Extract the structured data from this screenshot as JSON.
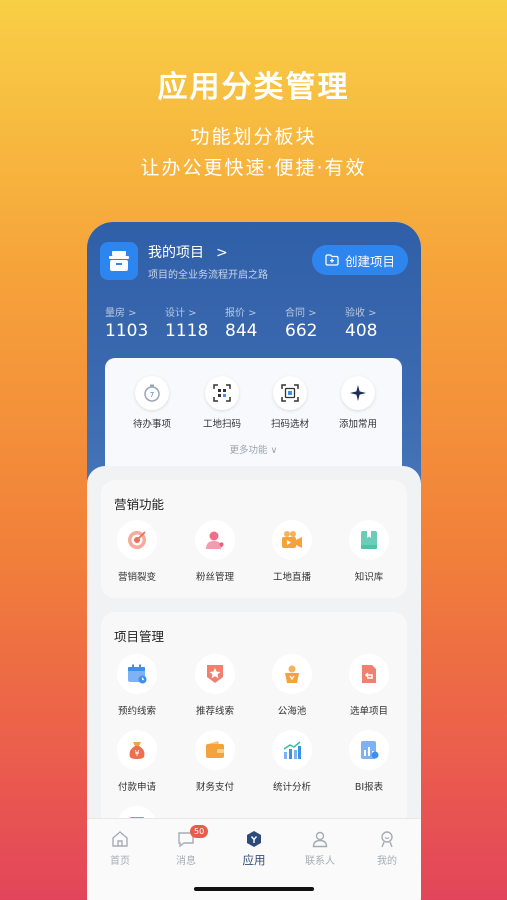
{
  "promo": {
    "title": "应用分类管理",
    "subtitle1": "功能划分板块",
    "subtitle2": "让办公更快速·便捷·有效"
  },
  "project": {
    "title": "我的项目",
    "chevron": ">",
    "desc": "项目的全业务流程开启之路",
    "create_label": "创建项目",
    "icon": "toolbox-icon"
  },
  "stats": [
    {
      "label": "量房 >",
      "value": "1103"
    },
    {
      "label": "设计 >",
      "value": "1118"
    },
    {
      "label": "报价 >",
      "value": "844"
    },
    {
      "label": "合同 >",
      "value": "662"
    },
    {
      "label": "验收 >",
      "value": "408"
    }
  ],
  "quick": {
    "items": [
      {
        "label": "待办事项",
        "icon": "stopwatch-icon"
      },
      {
        "label": "工地扫码",
        "icon": "scan-icon"
      },
      {
        "label": "扫码选材",
        "icon": "scan-material-icon"
      },
      {
        "label": "添加常用",
        "icon": "plus-star-icon"
      }
    ],
    "more": "更多功能  ∨"
  },
  "marketing": {
    "title": "营销功能",
    "items": [
      {
        "label": "营销裂变",
        "icon": "target-icon",
        "color": "#ee6f60"
      },
      {
        "label": "粉丝管理",
        "icon": "fan-user-icon",
        "color": "#ef6f8a"
      },
      {
        "label": "工地直播",
        "icon": "video-camera-icon",
        "color": "#f4a23c"
      },
      {
        "label": "知识库",
        "icon": "book-icon",
        "color": "#4fc1a9"
      }
    ]
  },
  "project_mgmt": {
    "title": "项目管理",
    "items": [
      {
        "label": "预约线索",
        "icon": "calendar-icon",
        "color": "#3d8ff0"
      },
      {
        "label": "推荐线索",
        "icon": "star-badge-icon",
        "color": "#ee5c4f"
      },
      {
        "label": "公海池",
        "icon": "trophy-icon",
        "color": "#f4a23c"
      },
      {
        "label": "选单项目",
        "icon": "document-return-icon",
        "color": "#ee5c4f"
      },
      {
        "label": "付款申请",
        "icon": "money-bag-icon",
        "color": "#ee6f50"
      },
      {
        "label": "财务支付",
        "icon": "wallet-icon",
        "color": "#f4a23c"
      },
      {
        "label": "统计分析",
        "icon": "bar-chart-icon",
        "color": "#3d8ff0"
      },
      {
        "label": "BI报表",
        "icon": "report-icon",
        "color": "#3d8ff0"
      }
    ]
  },
  "tabbar": {
    "items": [
      {
        "label": "首页",
        "icon": "home-icon"
      },
      {
        "label": "消息",
        "icon": "message-icon",
        "badge": "50"
      },
      {
        "label": "应用",
        "icon": "apps-icon"
      },
      {
        "label": "联系人",
        "icon": "contacts-icon"
      },
      {
        "label": "我的",
        "icon": "profile-icon"
      }
    ]
  },
  "colors": {
    "header": "#2f5fa8",
    "accent_blue": "#2f85ee",
    "badge": "#e95b4c"
  }
}
